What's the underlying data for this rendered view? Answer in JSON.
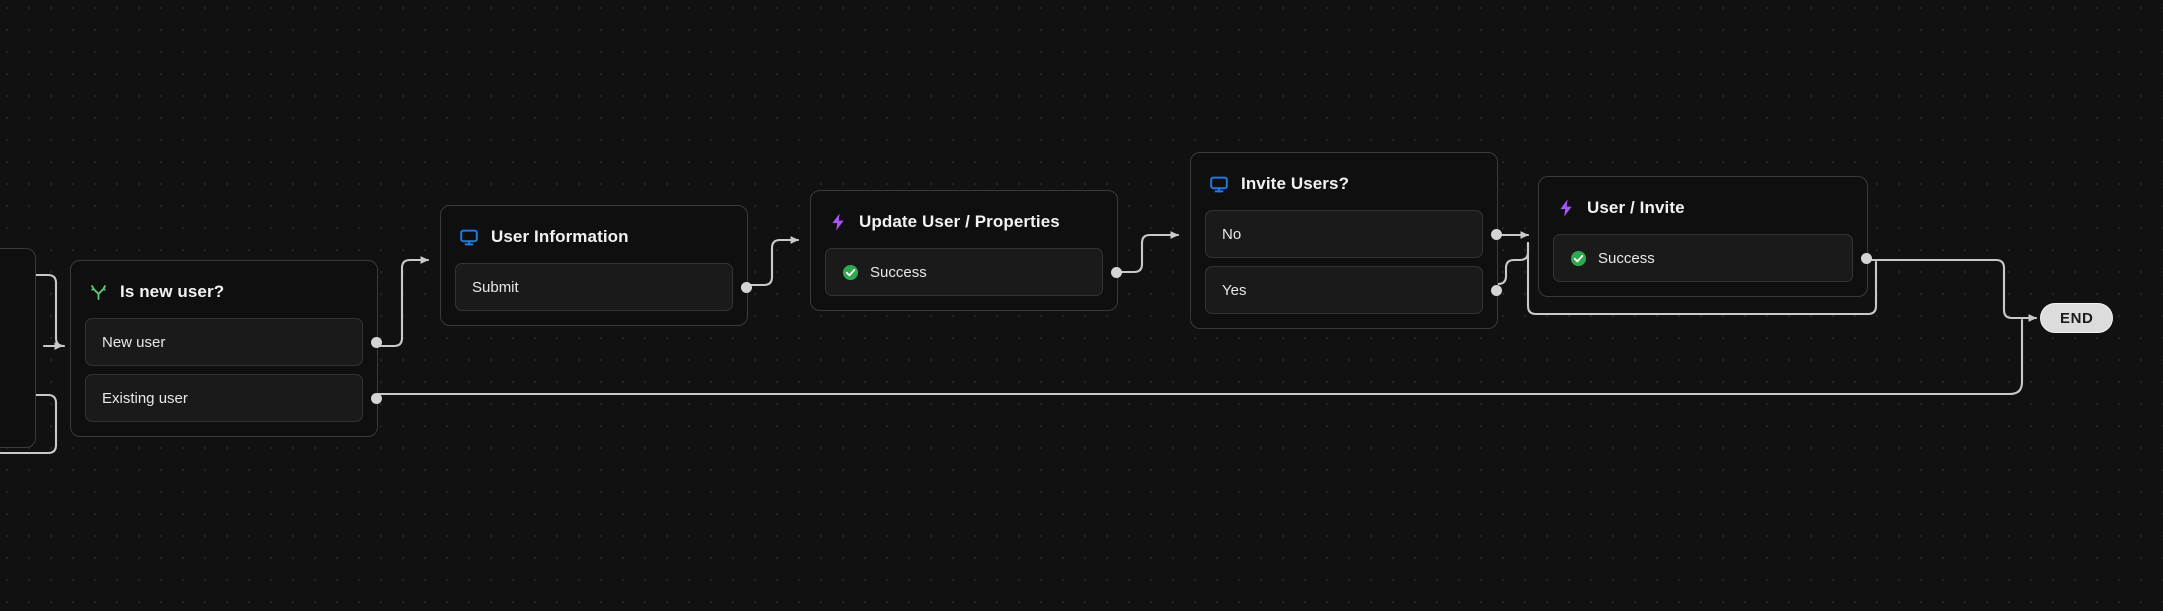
{
  "canvas": {
    "background_color": "#111111",
    "grid": "dot-grid",
    "edge_color": "#d0d0d0",
    "node_background": "#0f0f0f",
    "node_border": "#3a3a3a",
    "port_background": "#1a1a1a",
    "port_border": "#343434"
  },
  "nodes": [
    {
      "id": "is-new-user",
      "title": "Is new user?",
      "icon": "branch-fork-icon",
      "icon_color": "#5cc878",
      "ports": [
        {
          "label": "New user",
          "icon": null
        },
        {
          "label": "Existing user",
          "icon": null
        }
      ]
    },
    {
      "id": "user-information",
      "title": "User Information",
      "icon": "monitor-screen-icon",
      "icon_color": "#1f7ae0",
      "ports": [
        {
          "label": "Submit",
          "icon": null
        }
      ]
    },
    {
      "id": "update-user-properties",
      "title": "Update User / Properties",
      "icon": "lightning-bolt-icon",
      "icon_color": "#a855f7",
      "ports": [
        {
          "label": "Success",
          "icon": "success-check-icon"
        }
      ]
    },
    {
      "id": "invite-users",
      "title": "Invite Users?",
      "icon": "monitor-screen-icon",
      "icon_color": "#1f7ae0",
      "ports": [
        {
          "label": "No",
          "icon": null
        },
        {
          "label": "Yes",
          "icon": null
        }
      ]
    },
    {
      "id": "user-invite",
      "title": "User / Invite",
      "icon": "lightning-bolt-icon",
      "icon_color": "#a855f7",
      "ports": [
        {
          "label": "Success",
          "icon": "success-check-icon"
        }
      ]
    }
  ],
  "terminal": {
    "label": "END",
    "background": "#dcdcdc",
    "text_color": "#1b1b1b"
  },
  "status_icon": {
    "name": "success-check-icon",
    "color": "#2fa84f"
  }
}
